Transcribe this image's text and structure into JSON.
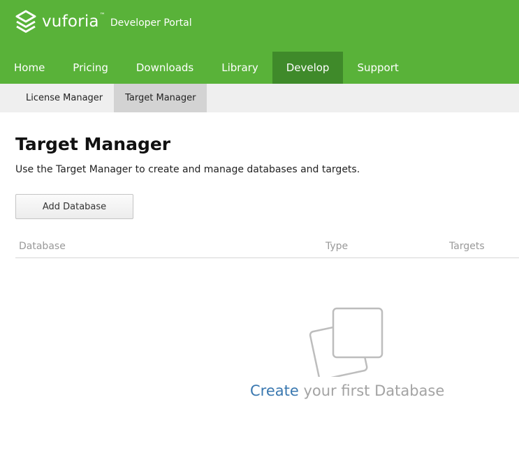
{
  "header": {
    "brand": "vuforia",
    "trademark": "™",
    "subtitle": "Developer Portal",
    "bg_color": "#59b239",
    "active_nav_color": "#3f8a2a"
  },
  "main_nav": {
    "items": [
      {
        "label": "Home",
        "active": false
      },
      {
        "label": "Pricing",
        "active": false
      },
      {
        "label": "Downloads",
        "active": false
      },
      {
        "label": "Library",
        "active": false
      },
      {
        "label": "Develop",
        "active": true
      },
      {
        "label": "Support",
        "active": false
      }
    ]
  },
  "sub_nav": {
    "items": [
      {
        "label": "License Manager",
        "active": false
      },
      {
        "label": "Target Manager",
        "active": true
      }
    ]
  },
  "page": {
    "title": "Target Manager",
    "description": "Use the Target Manager to create and manage databases and targets."
  },
  "actions": {
    "add_database_label": "Add Database"
  },
  "table": {
    "columns": [
      "Database",
      "Type",
      "Targets"
    ],
    "rows": []
  },
  "empty_state": {
    "icon": "stacked-squares-icon",
    "link_text": "Create",
    "text": " your first Database",
    "link_color": "#3a78b0"
  }
}
